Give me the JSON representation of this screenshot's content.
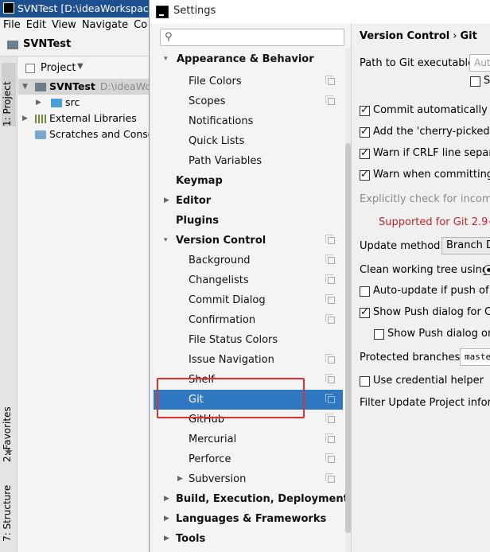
{
  "ide": {
    "title": "SVNTest [D:\\ideaWorkspace",
    "menu": [
      "File",
      "Edit",
      "View",
      "Navigate",
      "Co"
    ],
    "project_name": "SVNTest",
    "tool_tabs": {
      "project": "1: Project",
      "favorites": "2: Favorites",
      "structure": "7: Structure"
    },
    "project_panel": {
      "header": "Project",
      "tree": [
        {
          "name": "SVNTest",
          "path": "D:\\ideaWor"
        },
        {
          "name": "src"
        },
        {
          "name": "External Libraries"
        },
        {
          "name": "Scratches and Consol"
        }
      ]
    }
  },
  "dialog": {
    "title": "Settings",
    "search": {
      "value": "",
      "placeholder": ""
    },
    "nav": [
      {
        "label": "Appearance & Behavior"
      },
      {
        "label": "File Colors"
      },
      {
        "label": "Scopes"
      },
      {
        "label": "Notifications"
      },
      {
        "label": "Quick Lists"
      },
      {
        "label": "Path Variables"
      },
      {
        "label": "Keymap"
      },
      {
        "label": "Editor"
      },
      {
        "label": "Plugins"
      },
      {
        "label": "Version Control"
      },
      {
        "label": "Background"
      },
      {
        "label": "Changelists"
      },
      {
        "label": "Commit Dialog"
      },
      {
        "label": "Confirmation"
      },
      {
        "label": "File Status Colors"
      },
      {
        "label": "Issue Navigation"
      },
      {
        "label": "Shelf"
      },
      {
        "label": "Git"
      },
      {
        "label": "GitHub"
      },
      {
        "label": "Mercurial"
      },
      {
        "label": "Perforce"
      },
      {
        "label": "Subversion"
      },
      {
        "label": "Build, Execution, Deployment"
      },
      {
        "label": "Languages & Frameworks"
      },
      {
        "label": "Tools"
      }
    ],
    "selected": "Git",
    "right": {
      "breadcrumb": [
        "Version Control",
        "Git"
      ],
      "path_label": "Path to Git executable:",
      "path_value": "Auto",
      "path_check": "S",
      "checks": [
        {
          "label": "Commit automatically on",
          "checked": true
        },
        {
          "label": "Add the 'cherry-picked fr",
          "checked": true
        },
        {
          "label": "Warn if CRLF line separat",
          "checked": true
        },
        {
          "label": "Warn when committing in",
          "checked": true
        }
      ],
      "incoming_label": "Explicitly check for incoming",
      "supported_label": "Supported for Git 2.9+",
      "update_method_label": "Update method:",
      "update_method_value": "Branch De",
      "clean_tree_label": "Clean working tree using:",
      "auto_update": {
        "label": "Auto-update if push of th",
        "checked": false
      },
      "show_push": {
        "label": "Show Push dialog for Cor",
        "checked": true
      },
      "show_push_only": {
        "label": "Show Push dialog only",
        "checked": false
      },
      "protected_label": "Protected branches:",
      "protected_value": "master",
      "credential": {
        "label": "Use credential helper",
        "checked": false
      },
      "filter_label": "Filter Update Project informa"
    },
    "colors": {
      "selection": "#2f78c1",
      "supported_text": "#c0272d",
      "highlight_box": "#e0302f",
      "muted_text": "#8a8a8a"
    }
  }
}
